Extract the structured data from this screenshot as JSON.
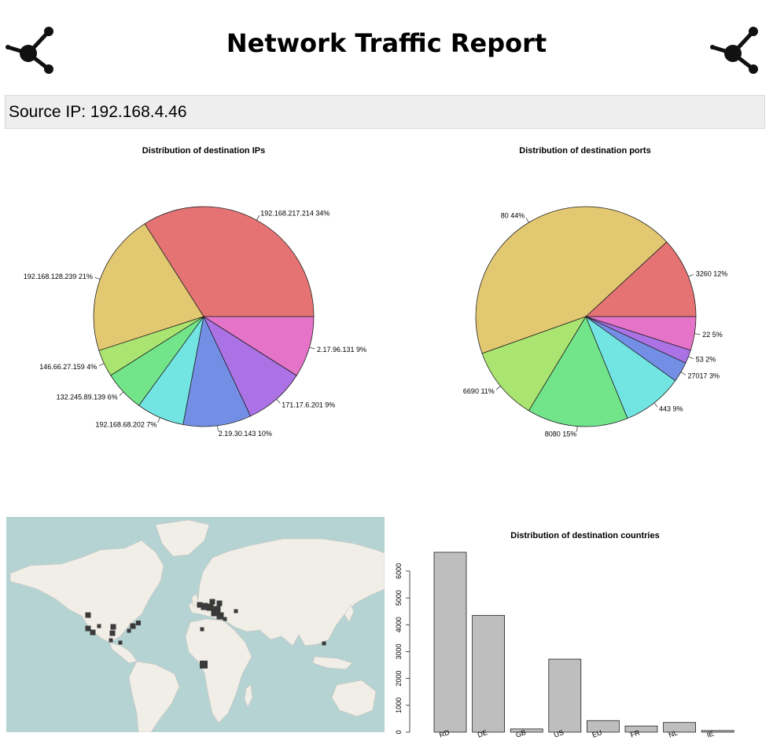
{
  "header": {
    "title": "Network Traffic Report",
    "left_icon": "share-icon",
    "right_icon": "share-icon"
  },
  "source": {
    "label": "Source IP: 192.168.4.46"
  },
  "chart_data": [
    {
      "type": "pie",
      "title": "Distribution of destination IPs",
      "slices": [
        {
          "label": "192.168.217.214 34%",
          "value": 34,
          "color": "#E57373"
        },
        {
          "label": "192.168.128.239 21%",
          "value": 21,
          "color": "#E3C872"
        },
        {
          "label": "146.66.27.159 4%",
          "value": 4,
          "color": "#ABE571"
        },
        {
          "label": "132.245.89.139 6%",
          "value": 6,
          "color": "#72E58B"
        },
        {
          "label": "192.168.68.202 7%",
          "value": 7,
          "color": "#72E5E3"
        },
        {
          "label": "2.19.30.143 10%",
          "value": 10,
          "color": "#738FE5"
        },
        {
          "label": "171.17.6.201 9%",
          "value": 9,
          "color": "#AB72E5"
        },
        {
          "label": "2.17.96.131 9%",
          "value": 9,
          "color": "#E573C8"
        }
      ]
    },
    {
      "type": "pie",
      "title": "Distribution of destination ports",
      "slices": [
        {
          "label": "3260 12%",
          "value": 12,
          "color": "#E57373"
        },
        {
          "label": "80 44%",
          "value": 44,
          "color": "#E3C872"
        },
        {
          "label": "6690 11%",
          "value": 11,
          "color": "#ABE571"
        },
        {
          "label": "8080 15%",
          "value": 15,
          "color": "#72E58B"
        },
        {
          "label": "443 9%",
          "value": 9,
          "color": "#72E5E3"
        },
        {
          "label": "27017 3%",
          "value": 3,
          "color": "#738FE5"
        },
        {
          "label": "53 2%",
          "value": 2,
          "color": "#AB72E5"
        },
        {
          "label": "22 5%",
          "value": 5,
          "color": "#E573C8"
        }
      ]
    },
    {
      "type": "bar",
      "title": "Distribution of destination countries",
      "categories": [
        "RD",
        "DE",
        "GB",
        "US",
        "EU",
        "FR",
        "NL",
        "IE"
      ],
      "values": [
        6700,
        4350,
        120,
        2720,
        430,
        230,
        360,
        60
      ],
      "yticks": [
        0,
        1000,
        2000,
        3000,
        4000,
        5000,
        6000
      ],
      "ylim": [
        0,
        6700
      ],
      "bar_color": "#BEBEBE"
    }
  ],
  "map": {
    "land_color": "#F1EEE8",
    "water_color": "#B5D3D3",
    "marker_color": "#3A3A3A"
  }
}
